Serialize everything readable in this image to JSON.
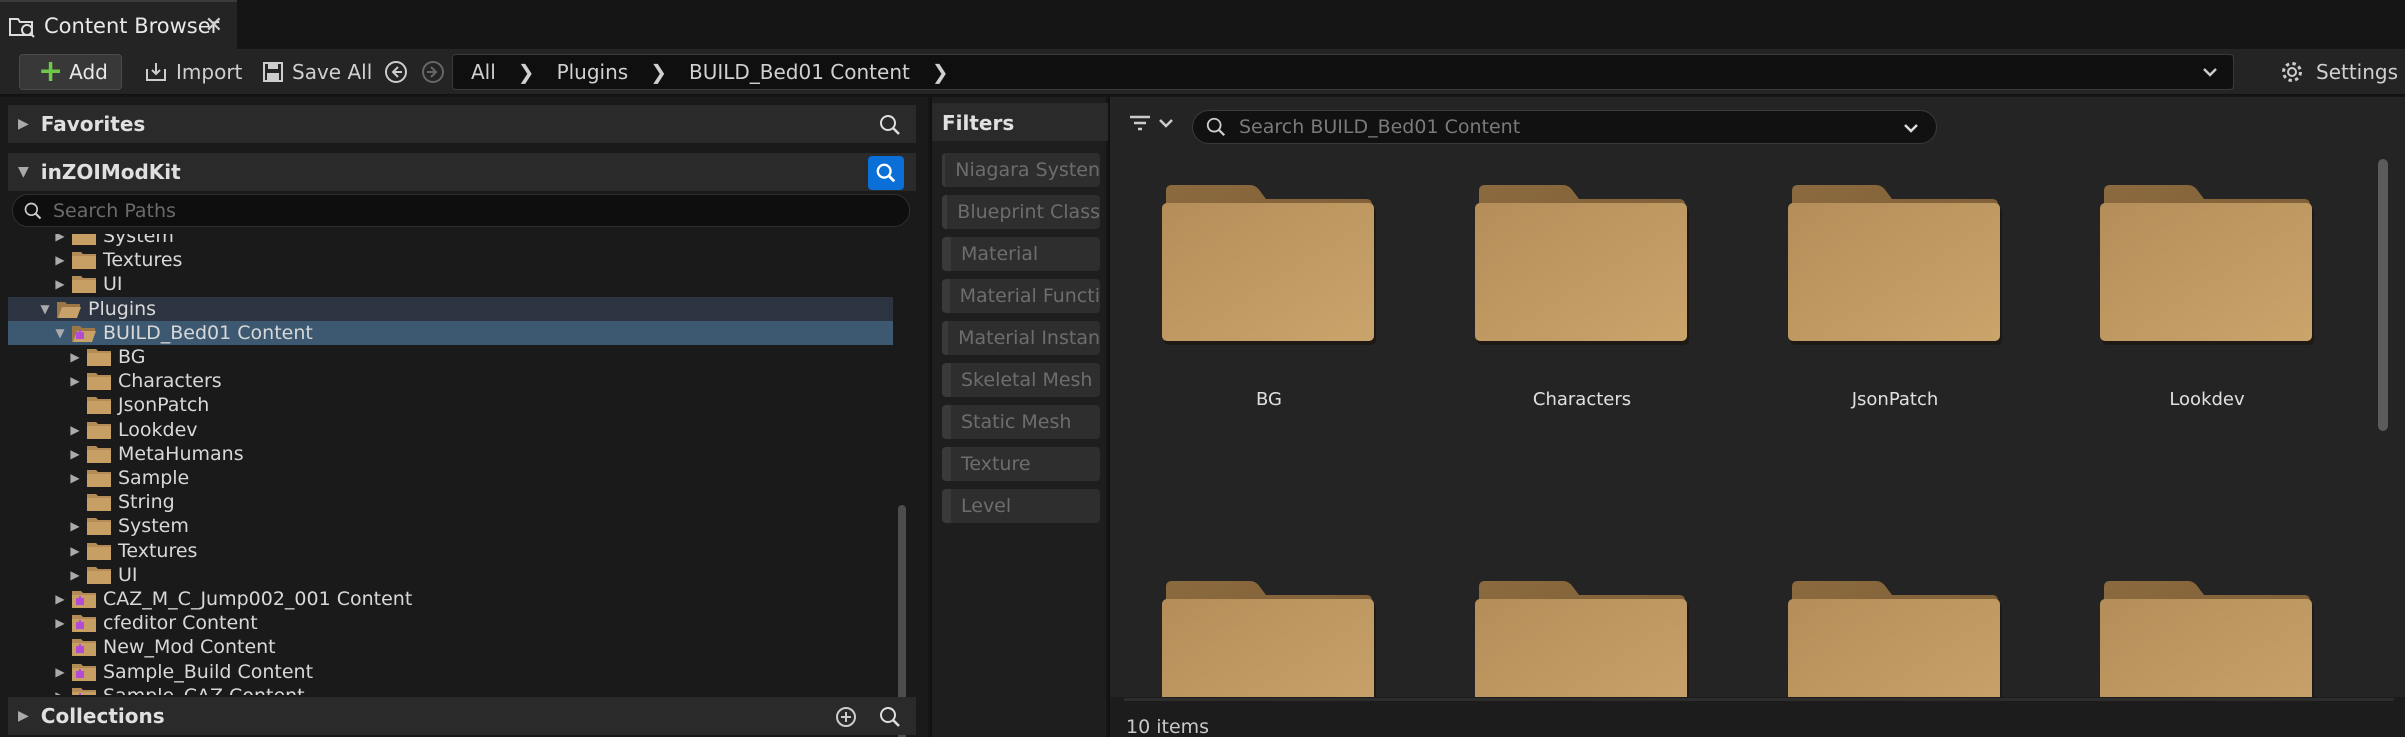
{
  "tab": {
    "title": "Content Browser",
    "close": "✕"
  },
  "toolbar": {
    "add_label": "Add",
    "import_label": "Import",
    "saveall_label": "Save All",
    "settings_label": "Settings"
  },
  "breadcrumb": {
    "items": [
      "All",
      "Plugins",
      "BUILD_Bed01 Content"
    ]
  },
  "sidebar": {
    "favorites_label": "Favorites",
    "root_label": "inZOIModKit",
    "search_placeholder": "Search Paths",
    "collections_label": "Collections",
    "tree": [
      {
        "label": "System",
        "depth": 3,
        "caret": "right",
        "icon": "folder"
      },
      {
        "label": "Textures",
        "depth": 3,
        "caret": "right",
        "icon": "folder"
      },
      {
        "label": "UI",
        "depth": 3,
        "caret": "right",
        "icon": "folder"
      },
      {
        "label": "Plugins",
        "depth": 2,
        "caret": "down",
        "icon": "folder-open"
      },
      {
        "label": "BUILD_Bed01 Content",
        "depth": 3,
        "caret": "down",
        "icon": "plugin-folder-open",
        "selected": true
      },
      {
        "label": "BG",
        "depth": 4,
        "caret": "right",
        "icon": "folder"
      },
      {
        "label": "Characters",
        "depth": 4,
        "caret": "right",
        "icon": "folder"
      },
      {
        "label": "JsonPatch",
        "depth": 4,
        "caret": "none",
        "icon": "folder"
      },
      {
        "label": "Lookdev",
        "depth": 4,
        "caret": "right",
        "icon": "folder"
      },
      {
        "label": "MetaHumans",
        "depth": 4,
        "caret": "right",
        "icon": "folder"
      },
      {
        "label": "Sample",
        "depth": 4,
        "caret": "right",
        "icon": "folder"
      },
      {
        "label": "String",
        "depth": 4,
        "caret": "none",
        "icon": "folder"
      },
      {
        "label": "System",
        "depth": 4,
        "caret": "right",
        "icon": "folder"
      },
      {
        "label": "Textures",
        "depth": 4,
        "caret": "right",
        "icon": "folder"
      },
      {
        "label": "UI",
        "depth": 4,
        "caret": "right",
        "icon": "folder"
      },
      {
        "label": "CAZ_M_C_Jump002_001 Content",
        "depth": 3,
        "caret": "right",
        "icon": "plugin-folder"
      },
      {
        "label": "cfeditor Content",
        "depth": 3,
        "caret": "right",
        "icon": "plugin-folder"
      },
      {
        "label": "New_Mod Content",
        "depth": 3,
        "caret": "none",
        "icon": "plugin-folder"
      },
      {
        "label": "Sample_Build Content",
        "depth": 3,
        "caret": "right",
        "icon": "plugin-folder"
      },
      {
        "label": "Sample_CAZ Content",
        "depth": 3,
        "caret": "right",
        "icon": "plugin-folder"
      }
    ]
  },
  "filters": {
    "title": "Filters",
    "items": [
      "Niagara Systen",
      "Blueprint Class",
      "Material",
      "Material Functi",
      "Material Instan",
      "Skeletal Mesh",
      "Static Mesh",
      "Texture",
      "Level"
    ]
  },
  "content": {
    "search_placeholder": "Search BUILD_Bed01 Content",
    "folders": [
      "BG",
      "Characters",
      "JsonPatch",
      "Lookdev",
      "",
      "",
      "",
      ""
    ],
    "item_count": "10 items"
  },
  "colors": {
    "accent": "#0a6fd6",
    "folder": "#b38b57",
    "selection": "#3d5871",
    "add_plus": "#6ec84a"
  }
}
